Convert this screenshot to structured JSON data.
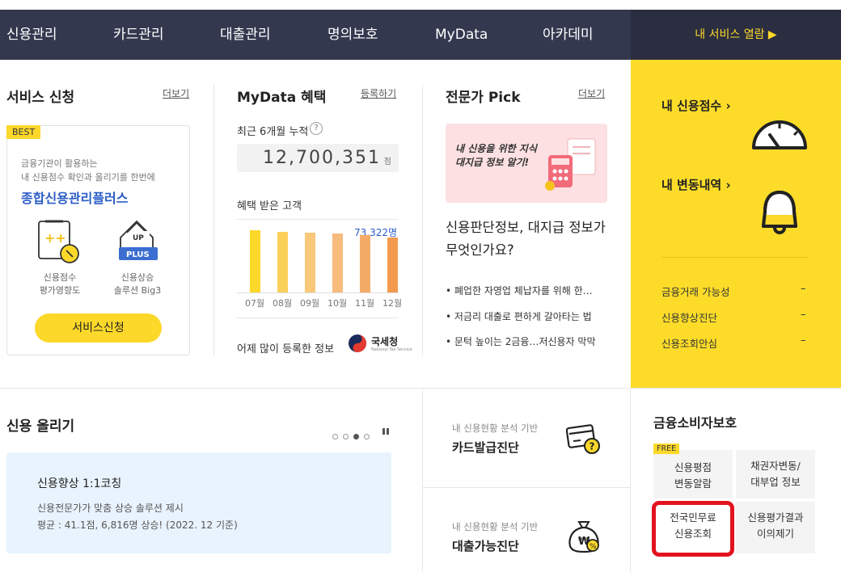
{
  "nav": {
    "items": [
      "신용관리",
      "카드관리",
      "대출관리",
      "명의보호",
      "MyData",
      "아카데미"
    ],
    "service_open": "내 서비스 열람 ▶"
  },
  "service_apply": {
    "title": "서비스 신청",
    "more": "더보기",
    "badge": "BEST",
    "desc1": "금융기관이 활용하는",
    "desc2": "내 신용점수 확인과 올리기를 한번에",
    "product": "종합신용관리플러스",
    "icon1_label1": "신용점수",
    "icon1_label2": "평가영향도",
    "icon2_label1": "신용상승",
    "icon2_label2": "솔루션 Big3",
    "icon2_tag_up": "UP",
    "icon2_tag_plus": "PLUS",
    "button": "서비스신청"
  },
  "mydata": {
    "title": "MyData 혜택",
    "register": "등록하기",
    "cumulative_label": "최근 6개월 누적",
    "help": "?",
    "cumulative_value": "12,700,351",
    "cumulative_unit": "점",
    "customers_label": "혜택 받은 고객",
    "latest_value": "73,322명",
    "popular_label": "어제 많이 등록한 정보",
    "agency": "국세청",
    "agency_en": "National Tax Service"
  },
  "chart_data": {
    "type": "bar",
    "categories": [
      "07월",
      "08월",
      "09월",
      "10월",
      "11월",
      "12월"
    ],
    "values": [
      68000,
      67000,
      66000,
      65000,
      63000,
      60000
    ],
    "ylim": [
      0,
      80000
    ],
    "colors": [
      "#fcd82a",
      "#fbd059",
      "#f9c87a",
      "#f6bb7d",
      "#f4ab66",
      "#f39a4f"
    ],
    "annotation": "73,322명"
  },
  "expert": {
    "title": "전문가 Pick",
    "more": "더보기",
    "promo1": "내 신용을 위한 지식",
    "promo2": "대지급 정보 알기!",
    "headline1": "신용판단정보, 대지급 정보가",
    "headline2": "무엇인가요?",
    "items": [
      "• 폐업한 자영업 체납자를 위해 한…",
      "• 저금리 대출로 편하게 갈아타는 법",
      "• 문턱 높이는 2금융…저신용자 막막"
    ]
  },
  "my_panel": {
    "score": "내 신용점수 ›",
    "changes": "내 변동내역 ›",
    "items": [
      "금융거래 가능성",
      "신용향상진단",
      "신용조회안심"
    ],
    "dash": "–"
  },
  "raise": {
    "title": "신용 올리기",
    "coach_title": "신용향상 1:1코칭",
    "coach_sub1": "신용전문가가 맞춤 상승 솔루션 제시",
    "coach_sub2": "평균 : 41.1점, 6,816명 상승! (2022. 12 기준)"
  },
  "diagnosis": [
    {
      "sub": "내 신용현황 분석 기반",
      "title": "카드발급진단"
    },
    {
      "sub": "내 신용현황 분석 기반",
      "title": "대출가능진단"
    }
  ],
  "consumer": {
    "title": "금융소비자보호",
    "free": "FREE",
    "box1a": "신용평점",
    "box1b": "변동알람",
    "box2a": "채권자변동/",
    "box2b": "대부업 정보",
    "box3a": "전국민무료",
    "box3b": "신용조회",
    "box4a": "신용평가결과",
    "box4b": "이의제기"
  }
}
